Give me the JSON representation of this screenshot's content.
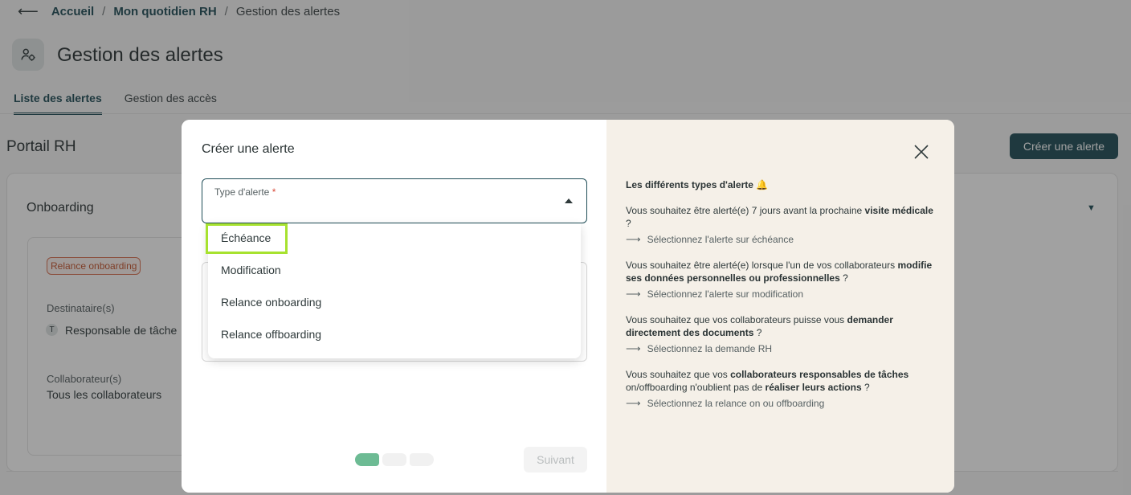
{
  "breadcrumb": {
    "back": "⟵",
    "items": [
      "Accueil",
      "Mon quotidien RH",
      "Gestion des alertes"
    ],
    "sep": "/"
  },
  "page": {
    "title": "Gestion des alertes"
  },
  "tabs": [
    {
      "label": "Liste des alertes",
      "active": true
    },
    {
      "label": "Gestion des accès",
      "active": false
    }
  ],
  "section": {
    "title": "Portail RH",
    "create_button": "Créer une alerte"
  },
  "card": {
    "title": "Onboarding",
    "badge": "Relance onboarding",
    "recipients_label": "Destinataire(s)",
    "recipient_initial": "T",
    "recipient_value": "Responsable de tâche",
    "collaborators_label": "Collaborateur(s)",
    "collaborators_value": "Tous les collaborateurs"
  },
  "modal": {
    "title": "Créer une alerte",
    "field_label": "Type d'alerte",
    "required_mark": "*",
    "options": [
      "Échéance",
      "Modification",
      "Relance onboarding",
      "Relance offboarding"
    ],
    "highlighted_option": "Échéance",
    "next_button": "Suivant",
    "steps": 3,
    "current_step": 1
  },
  "help": {
    "title": "Les différents types d'alerte 🔔",
    "q1_pre": "Vous souhaitez être alerté(e) 7 jours avant la prochaine ",
    "q1_bold": "visite médicale",
    "q1_post": " ?",
    "a1": "Sélectionnez l'alerte sur échéance",
    "q2_pre": "Vous souhaitez être alerté(e) lorsque l'un de vos collaborateurs ",
    "q2_bold": "modifie ses données personnelles ou professionnelles",
    "q2_post": " ?",
    "a2": "Sélectionnez l'alerte sur modification",
    "q3_pre": "Vous souhaitez que vos collaborateurs puisse vous ",
    "q3_bold": "demander directement des documents",
    "q3_post": " ?",
    "a3": "Sélectionnez la demande RH",
    "q4_pre": "Vous souhaitez que vos ",
    "q4_bold": "collaborateurs responsables de tâches",
    "q4_mid": " on/offboarding n'oublient pas de ",
    "q4_bold2": "réaliser leurs actions",
    "q4_post": " ?",
    "a4": "Sélectionnez la relance on ou offboarding",
    "arrow": "⟶"
  }
}
